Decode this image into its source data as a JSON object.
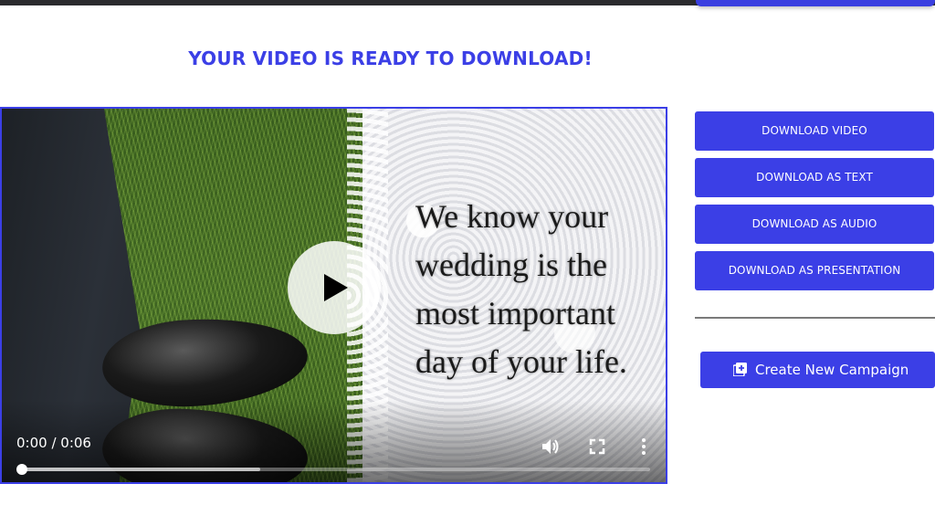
{
  "header": {
    "title": "YOUR VIDEO IS READY TO DOWNLOAD!"
  },
  "video": {
    "overlay_text": "We know your\nwedding is the\nmost important\nday of your life.",
    "time": "0:00 / 0:06",
    "progress_fraction": 0.0,
    "buffered_fraction": 0.38,
    "icons": {
      "play": "play-icon",
      "volume": "volume-icon",
      "fullscreen": "fullscreen-icon",
      "more": "more-vertical-icon"
    }
  },
  "actions": {
    "download_video": "DOWNLOAD VIDEO",
    "download_text": "DOWNLOAD AS TEXT",
    "download_audio": "DOWNLOAD AS AUDIO",
    "download_presentation": "DOWNLOAD AS PRESENTATION",
    "create_campaign": "Create New Campaign"
  },
  "colors": {
    "accent": "#3b3fe6",
    "topbar": "#2b2b2e"
  }
}
